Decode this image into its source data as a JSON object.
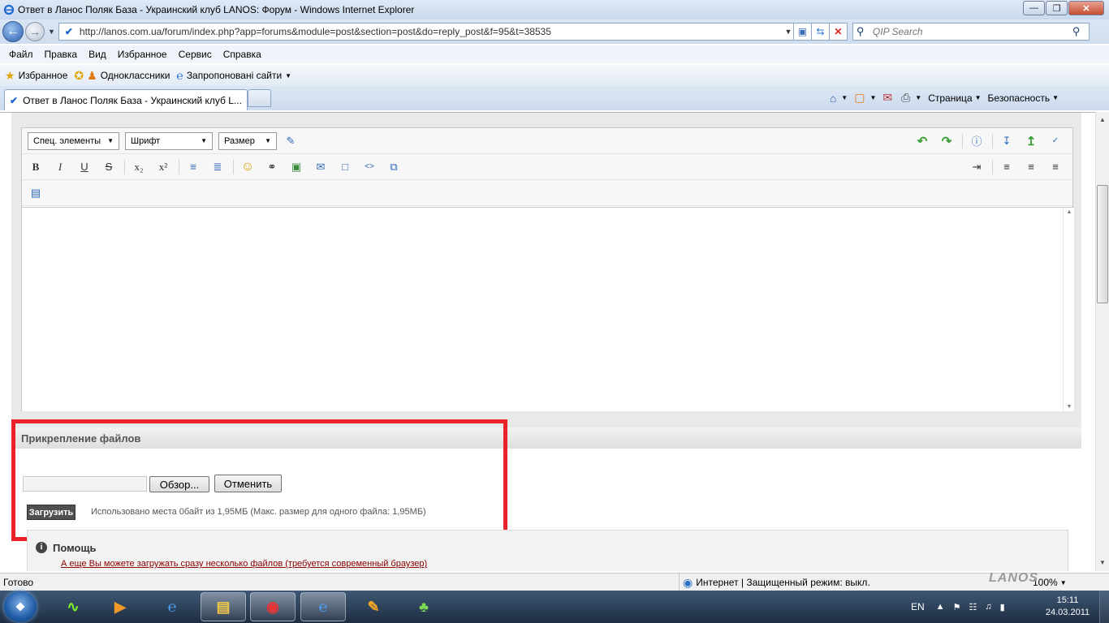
{
  "window": {
    "title": "Ответ в Ланос Поляк База - Украинский клуб LANOS: Форум - Windows Internet Explorer"
  },
  "address": {
    "url": "http://lanos.com.ua/forum/index.php?app=forums&module=post&section=post&do=reply_post&f=95&t=38535",
    "search_placeholder": "QIP Search"
  },
  "menu": [
    "Файл",
    "Правка",
    "Вид",
    "Избранное",
    "Сервис",
    "Справка"
  ],
  "favorites": {
    "label": "Избранное",
    "items": [
      "Одноклассники",
      "Запропоновані сайти"
    ]
  },
  "tab": {
    "title": "Ответ в Ланос Поляк База - Украинский клуб L..."
  },
  "commandbar": {
    "page": "Страница",
    "safety": "Безопасность"
  },
  "editor": {
    "special_elements": "Спец. элементы",
    "font": "Шрифт",
    "size": "Размер"
  },
  "attachments": {
    "header": "Прикрепление файлов",
    "browse": "Обзор...",
    "cancel": "Отменить",
    "upload": "Загрузить",
    "usage": "Использовано места 0байт из 1,95МБ (Макс. размер для одного файла: 1,95МБ)"
  },
  "help": {
    "title": "Помощь",
    "link": "А еще Вы можете загружать сразу несколько файлов (требуется современный браузер)"
  },
  "status": {
    "ready": "Готово",
    "zone": "Интернет | Защищенный режим: выкл.",
    "zoom": "100%"
  },
  "taskbar": {
    "lang": "EN",
    "time": "15:11",
    "date": "24.03.2011"
  },
  "watermark": "LANOS"
}
